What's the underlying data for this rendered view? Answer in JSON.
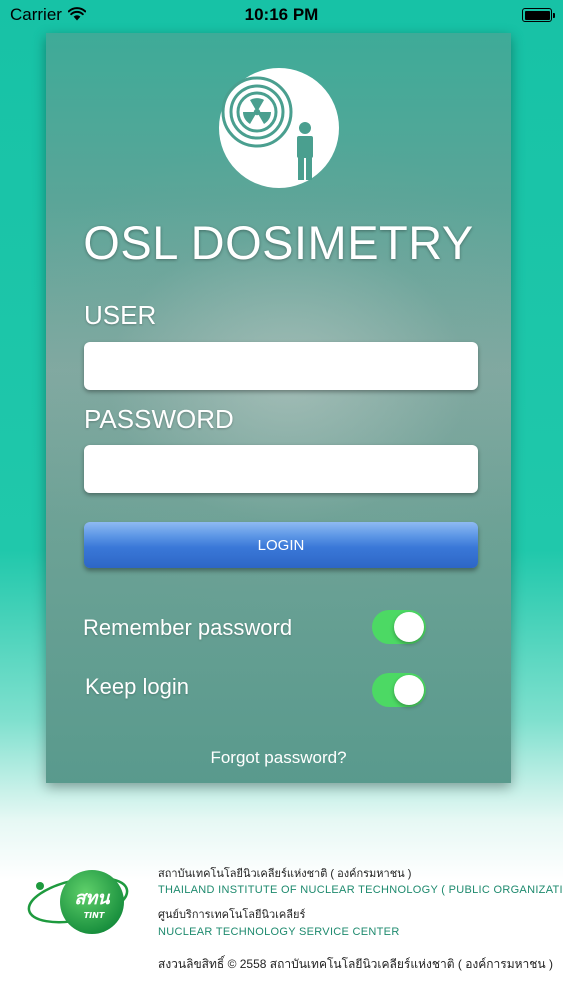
{
  "status_bar": {
    "carrier": "Carrier",
    "time": "10:16 PM"
  },
  "app": {
    "title": "OSL DOSIMETRY"
  },
  "login_form": {
    "user_label": "USER",
    "user_value": "",
    "password_label": "PASSWORD",
    "password_value": "",
    "login_button_label": "LOGIN",
    "remember_password_label": "Remember password",
    "remember_password_on": true,
    "keep_login_label": "Keep login",
    "keep_login_on": true,
    "forgot_password_label": "Forgot password?"
  },
  "footer": {
    "logo_text": "สทน",
    "logo_subtext": "TINT",
    "org_name_th": "สถาบันเทคโนโลยีนิวเคลียร์แห่งชาติ ( องค์กรมหาชน )",
    "org_name_en": "THAILAND INSTITUTE OF NUCLEAR TECHNOLOGY ( PUBLIC ORGANIZATION )",
    "center_name_th": "ศูนย์บริการเทคโนโลยีนิวเคลียร์",
    "center_name_en": "NUCLEAR TECHNOLOGY SERVICE CENTER",
    "copyright": "สงวนลิขสิทธิ์ © 2558 สถาบันเทคโนโลยีนิวเคลียร์แห่งชาติ ( องค์การมหาชน )"
  },
  "colors": {
    "background_accent": "#20c8ab",
    "toggle_on": "#4cd964",
    "login_button": "#3a78d8"
  },
  "icons": [
    "wifi-icon",
    "battery-icon",
    "radiation-dosimetry-logo-icon",
    "tint-logo-icon"
  ]
}
